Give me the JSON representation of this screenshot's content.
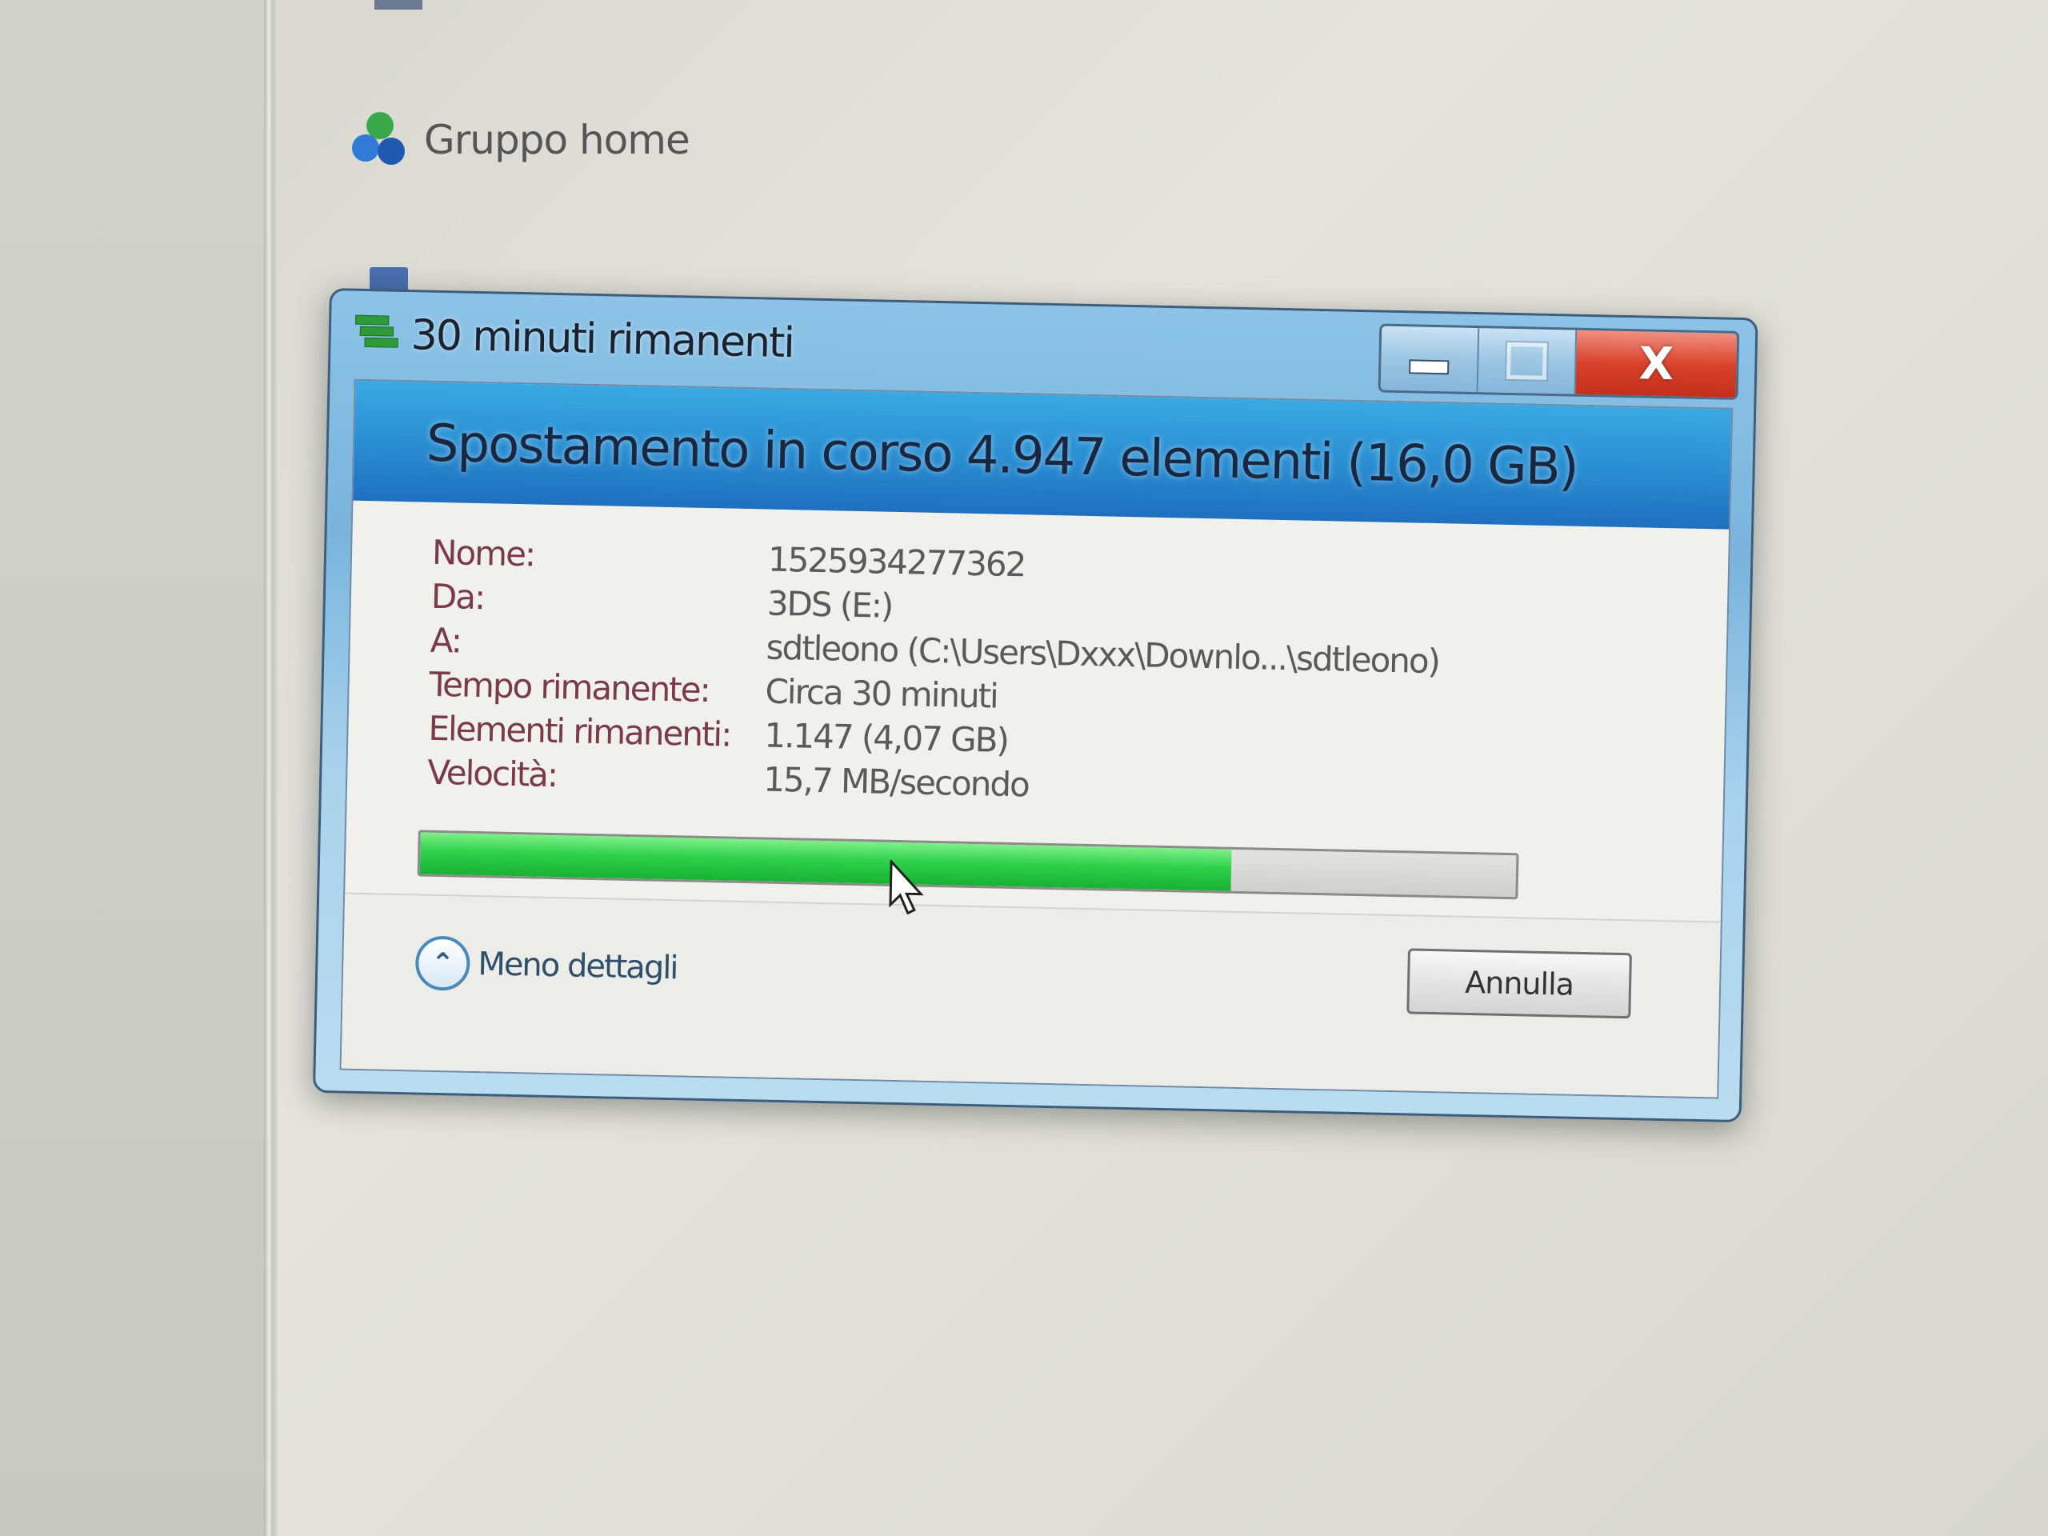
{
  "nav": {
    "homegroup_label": "Gruppo home"
  },
  "dialog": {
    "title": "30 minuti rimanenti",
    "header": "Spostamento in corso 4.947 elementi (16,0 GB)",
    "details": [
      {
        "label": "Nome:",
        "value": "1525934277362"
      },
      {
        "label": "Da:",
        "value": "3DS (E:)"
      },
      {
        "label": "A:",
        "value": "sdtleono (C:\\Users\\Dxxx\\Downlo...\\sdtleono)"
      },
      {
        "label": "Tempo rimanente:",
        "value": "Circa 30 minuti"
      },
      {
        "label": "Elementi rimanenti:",
        "value": "1.147 (4,07 GB)"
      },
      {
        "label": "Velocità:",
        "value": "15,7 MB/secondo"
      }
    ],
    "progress_fraction": 0.74,
    "less_details_label": "Meno dettagli",
    "cancel_label": "Annulla",
    "close_glyph": "X"
  },
  "colors": {
    "progress_green": "#2ed14a",
    "close_red": "#d9432c",
    "header_blue": "#2a8fd2"
  },
  "icons": {
    "homegroup": "homegroup-icon",
    "title": "file-copy-icon",
    "less_details": "chevron-up-icon",
    "cursor": "mouse-pointer-icon"
  }
}
